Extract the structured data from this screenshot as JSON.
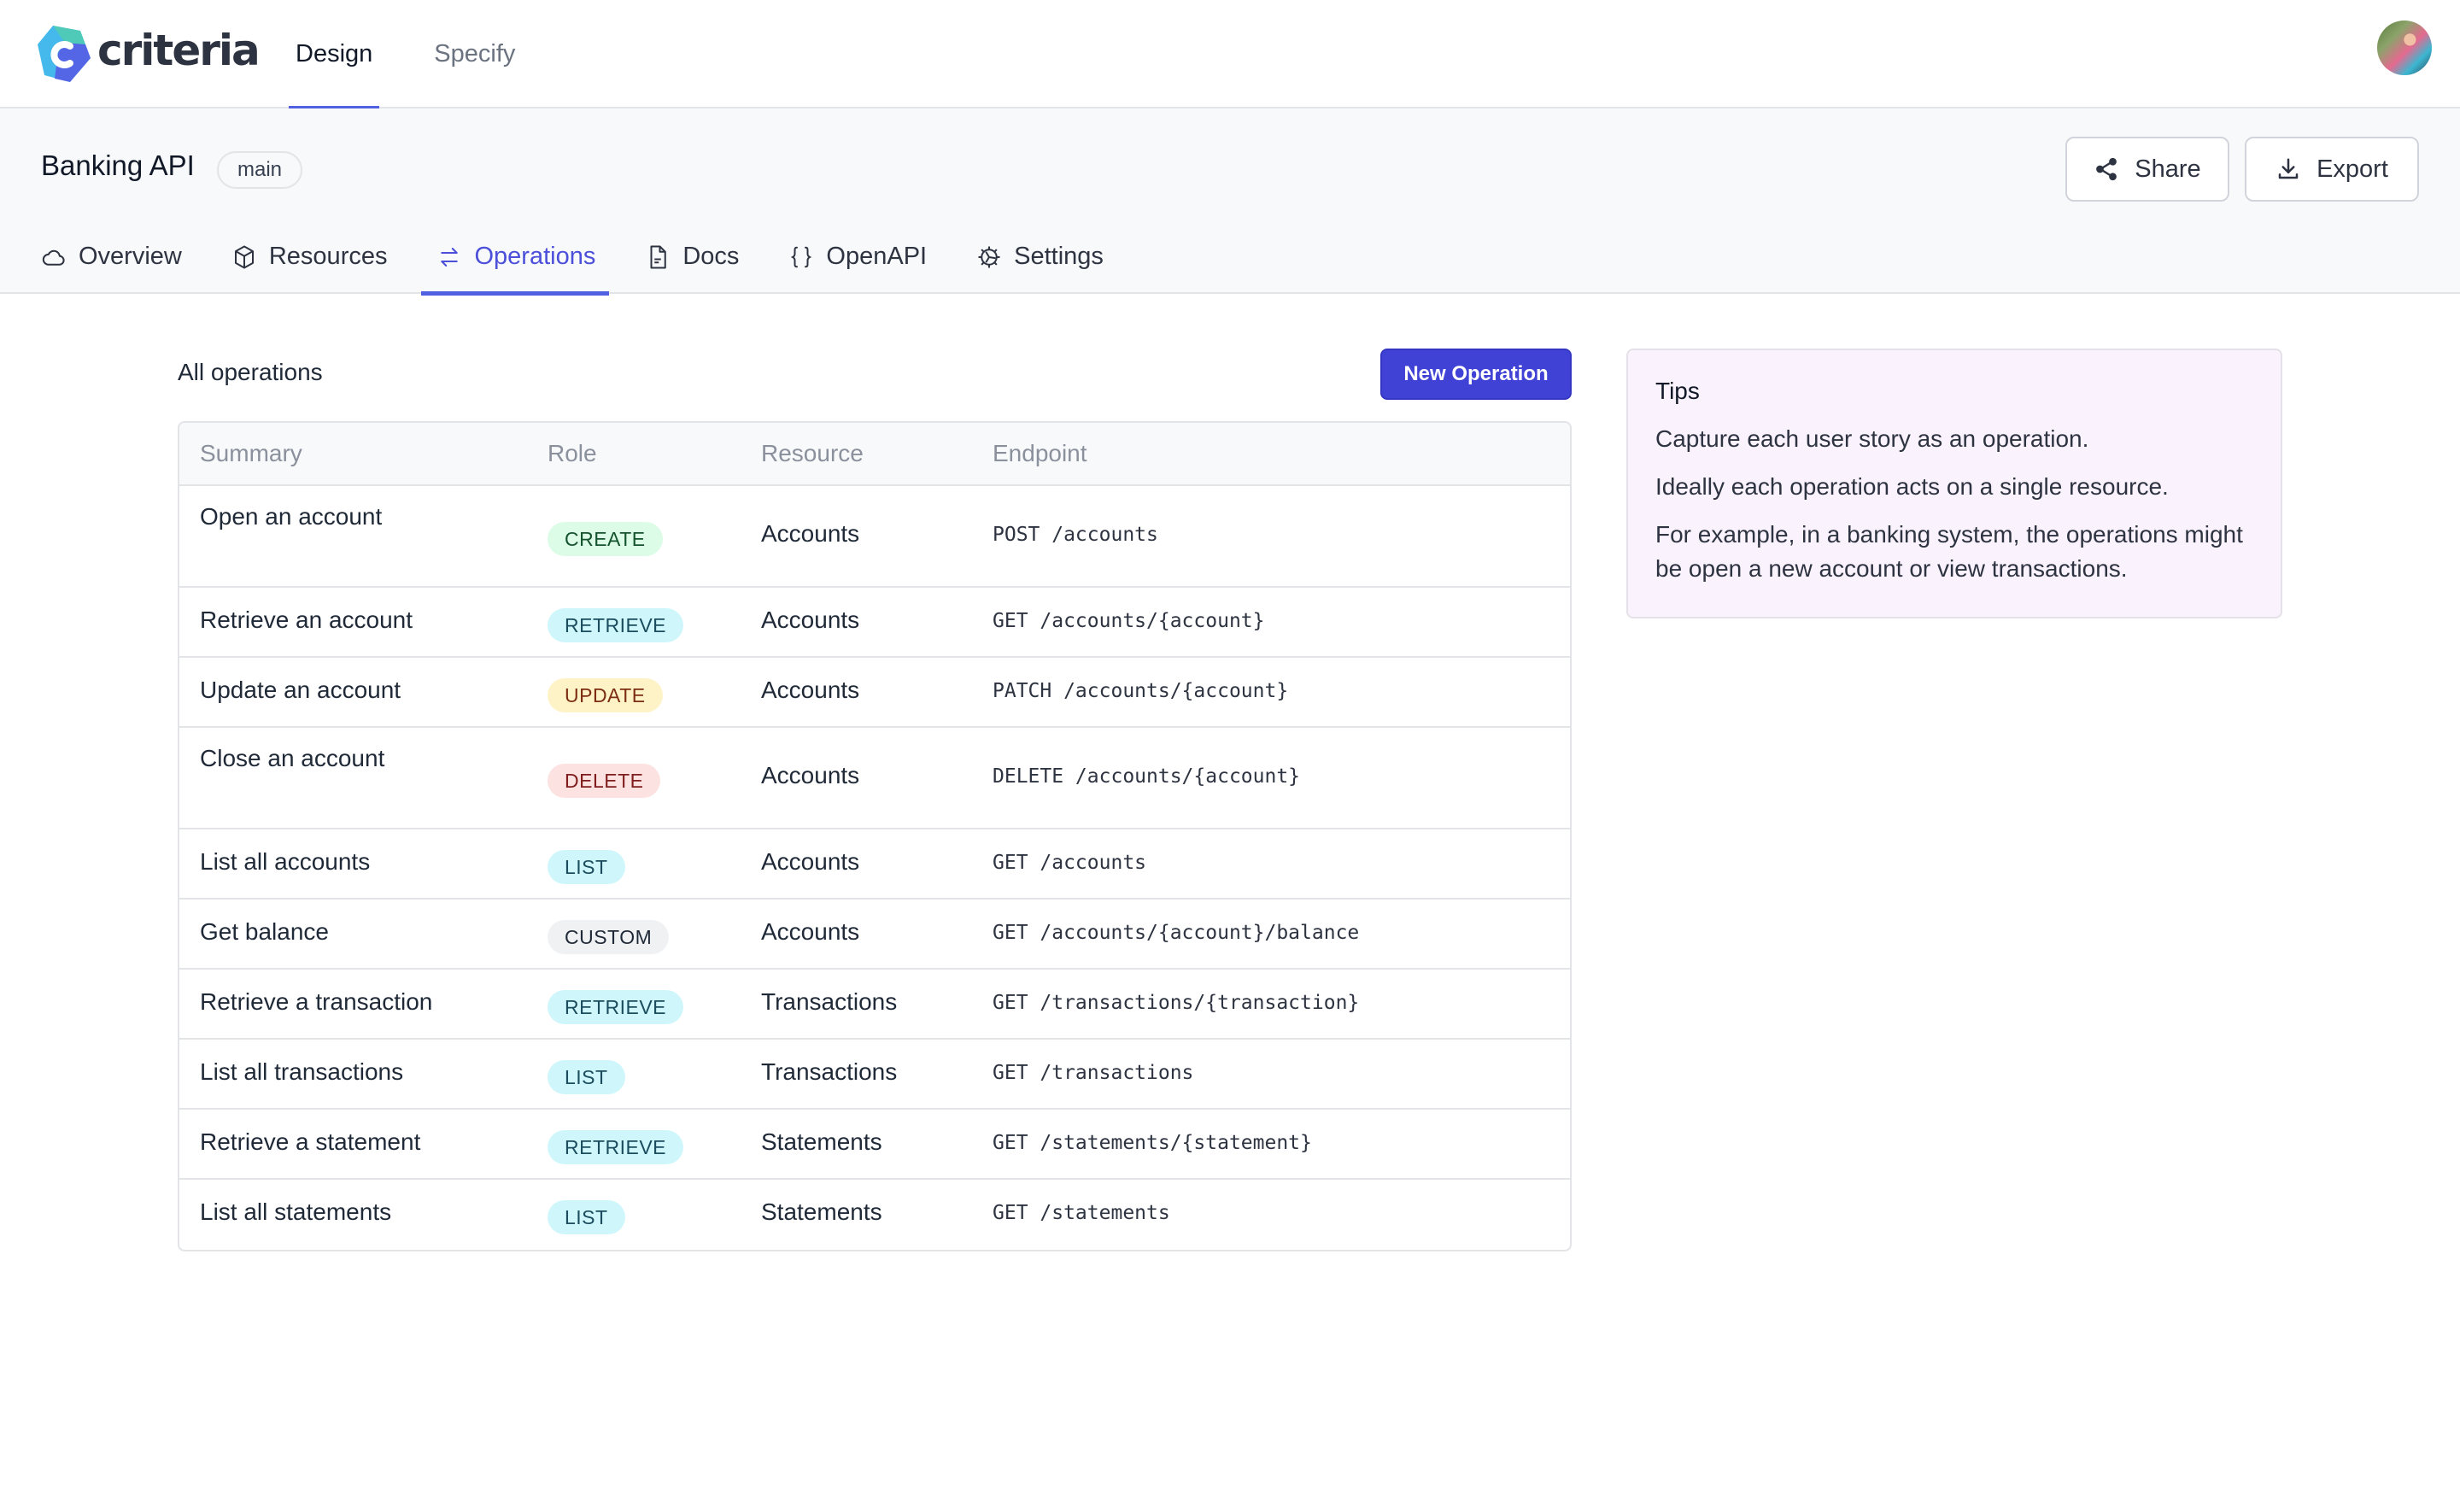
{
  "app": {
    "brand": "criteria",
    "top_nav": [
      {
        "label": "Design",
        "active": true
      },
      {
        "label": "Specify",
        "active": false
      }
    ],
    "avatar_alt": "User avatar"
  },
  "project": {
    "title": "Banking API",
    "branch": "main",
    "actions": {
      "share_label": "Share",
      "export_label": "Export"
    },
    "tabs": [
      {
        "label": "Overview",
        "icon": "cloud-icon",
        "active": false
      },
      {
        "label": "Resources",
        "icon": "cube-icon",
        "active": false
      },
      {
        "label": "Operations",
        "icon": "arrows-exchange-icon",
        "active": true
      },
      {
        "label": "Docs",
        "icon": "document-icon",
        "active": false
      },
      {
        "label": "OpenAPI",
        "icon": "braces-icon",
        "active": false
      },
      {
        "label": "Settings",
        "icon": "gear-icon",
        "active": false
      }
    ]
  },
  "operations": {
    "title": "All operations",
    "new_button_label": "New Operation",
    "columns": [
      "Summary",
      "Role",
      "Resource",
      "Endpoint"
    ],
    "rows": [
      {
        "summary": "Open an account",
        "role": "CREATE",
        "resource": "Accounts",
        "endpoint": "POST /accounts"
      },
      {
        "summary": "Retrieve an account",
        "role": "RETRIEVE",
        "resource": "Accounts",
        "endpoint": "GET /accounts/{account}"
      },
      {
        "summary": "Update an account",
        "role": "UPDATE",
        "resource": "Accounts",
        "endpoint": "PATCH /accounts/{account}"
      },
      {
        "summary": "Close an account",
        "role": "DELETE",
        "resource": "Accounts",
        "endpoint": "DELETE /accounts/{account}"
      },
      {
        "summary": "List all accounts",
        "role": "LIST",
        "resource": "Accounts",
        "endpoint": "GET /accounts"
      },
      {
        "summary": "Get balance",
        "role": "CUSTOM",
        "resource": "Accounts",
        "endpoint": "GET /accounts/{account}/balance"
      },
      {
        "summary": "Retrieve a transaction",
        "role": "RETRIEVE",
        "resource": "Transactions",
        "endpoint": "GET /transactions/{transaction}"
      },
      {
        "summary": "List all transactions",
        "role": "LIST",
        "resource": "Transactions",
        "endpoint": "GET /transactions"
      },
      {
        "summary": "Retrieve a statement",
        "role": "RETRIEVE",
        "resource": "Statements",
        "endpoint": "GET /statements/{statement}"
      },
      {
        "summary": "List all statements",
        "role": "LIST",
        "resource": "Statements",
        "endpoint": "GET /statements"
      }
    ]
  },
  "tips": {
    "title": "Tips",
    "paragraphs": [
      "Capture each user story as an operation.",
      "Ideally each operation acts on a single resource.",
      "For example, in a banking system, the operations might be open a new account or view transactions."
    ]
  },
  "colors": {
    "accent": "#5160e0",
    "primary_button": "#4042d6",
    "role_create": "#dcfce7",
    "role_retrieve": "#cff7fb",
    "role_list": "#cff7fb",
    "role_update": "#fef3c7",
    "role_delete": "#fde2e2",
    "role_custom": "#f0f1f3",
    "tips_background": "#faf3fd"
  }
}
